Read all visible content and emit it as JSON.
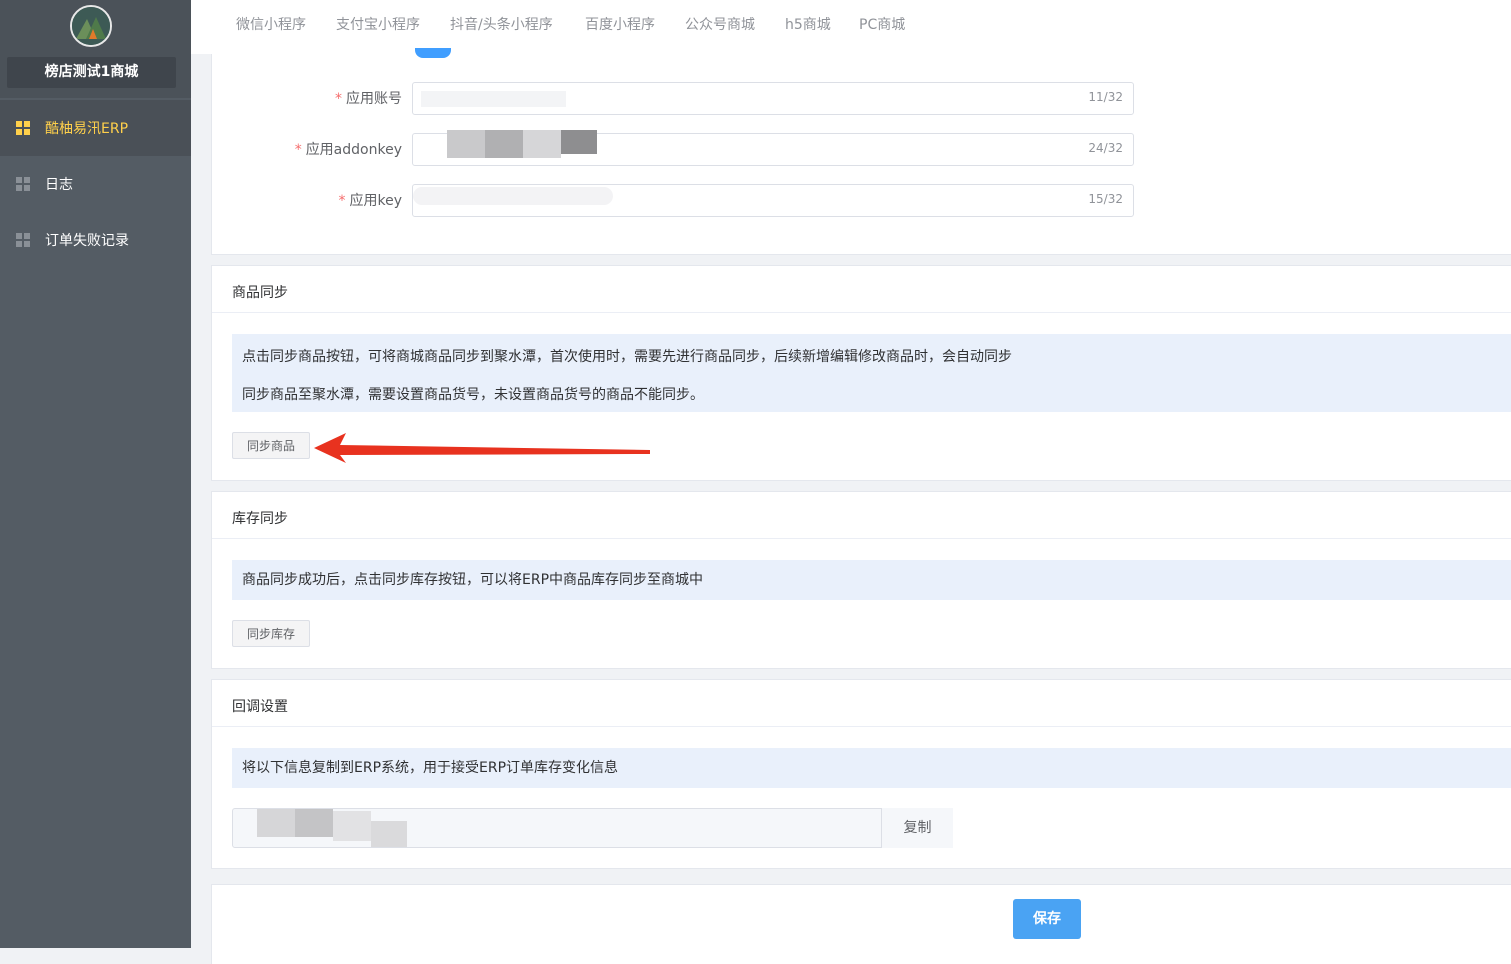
{
  "sidebar": {
    "shop_name": "榜店测试1商城",
    "items": [
      {
        "label": "酷柚易汛ERP",
        "icon": "grid-icon",
        "active": true
      },
      {
        "label": "日志",
        "icon": "grid-icon",
        "active": false
      },
      {
        "label": "订单失败记录",
        "icon": "grid-icon",
        "active": false
      }
    ]
  },
  "tabs": [
    "微信小程序",
    "支付宝小程序",
    "抖音/头条小程序",
    "百度小程序",
    "公众号商城",
    "h5商城",
    "PC商城"
  ],
  "form": {
    "fields": [
      {
        "label": "应用账号",
        "count": "11/32"
      },
      {
        "label": "应用addonkey",
        "count": "24/32"
      },
      {
        "label": "应用key",
        "count": "15/32"
      }
    ]
  },
  "goods_sync": {
    "title": "商品同步",
    "tip1": "点击同步商品按钮，可将商城商品同步到聚水潭，首次使用时，需要先进行商品同步，后续新增编辑修改商品时，会自动同步",
    "tip2": "同步商品至聚水潭，需要设置商品货号，未设置商品货号的商品不能同步。",
    "button": "同步商品"
  },
  "stock_sync": {
    "title": "库存同步",
    "tip": "商品同步成功后，点击同步库存按钮，可以将ERP中商品库存同步至商城中",
    "button": "同步库存"
  },
  "callback": {
    "title": "回调设置",
    "tip": "将以下信息复制到ERP系统，用于接受ERP订单库存变化信息",
    "copy_button": "复制"
  },
  "save_button": "保存",
  "colors": {
    "accent": "#4aa3f3",
    "sidebar": "#545c64",
    "active": "#ffd04b",
    "arrow": "#e8321f"
  }
}
